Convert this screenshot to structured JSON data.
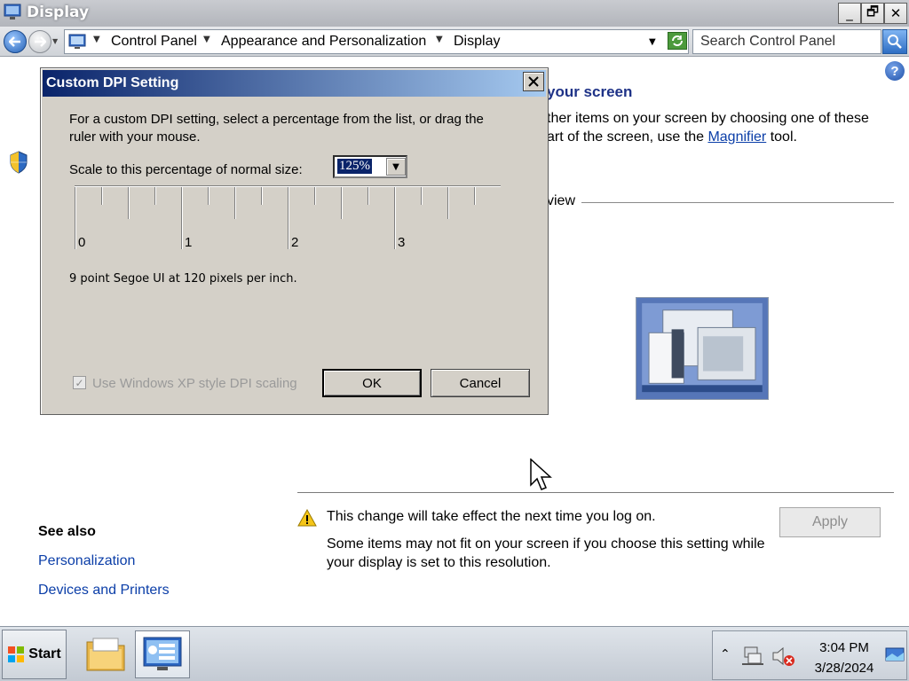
{
  "window": {
    "title": "Display",
    "min_label": "_",
    "max_label": "🗗",
    "close_label": "✕"
  },
  "navbar": {
    "breadcrumbs": [
      "Control Panel",
      "Appearance and Personalization",
      "Display"
    ],
    "search_placeholder": "Search Control Panel"
  },
  "page": {
    "heading": "your screen",
    "desc_prefix": "ther items on your screen by choosing one of these",
    "desc_line2_prefix": "art of the screen, use the ",
    "desc_link": "Magnifier",
    "desc_line2_suffix": " tool.",
    "preview_label": "view",
    "warning_title": "This change will take effect the next time you log on.",
    "warning_detail": "Some items may not fit on your screen if you choose this setting while your display is set to this resolution.",
    "apply_label": "Apply",
    "see_also_title": "See also",
    "see_also_links": [
      "Personalization",
      "Devices and Printers"
    ]
  },
  "dialog": {
    "title": "Custom DPI Setting",
    "intro": "For a custom DPI setting, select a percentage from the list, or drag the ruler with your mouse.",
    "scale_label": "Scale to this percentage of normal size:",
    "scale_value": "125%",
    "ruler_labels": [
      "0",
      "1",
      "2",
      "3"
    ],
    "font_info": "9 point Segoe UI at 120 pixels per inch.",
    "xp_scaling_label": "Use Windows XP style DPI scaling",
    "xp_scaling_checked": true,
    "ok_label": "OK",
    "cancel_label": "Cancel"
  },
  "taskbar": {
    "start_label": "Start",
    "items": [
      "folder-explorer-icon",
      "display-control-panel-icon"
    ],
    "clock_time": "3:04 PM",
    "clock_date": "3/28/2024"
  },
  "colors": {
    "dialog_bg": "#d4d0c8",
    "dialog_title_start": "#0a246a",
    "dialog_title_end": "#a6caf0",
    "link": "#0b3ea8",
    "heading": "#1e3287"
  }
}
